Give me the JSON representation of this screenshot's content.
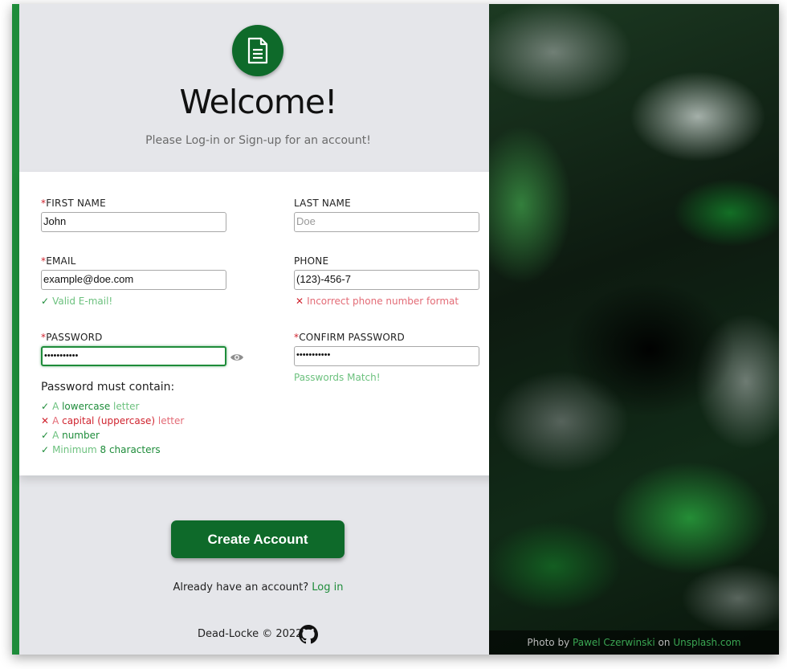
{
  "header": {
    "title": "Welcome!",
    "subtitle": "Please Log-in or Sign-up for an account!"
  },
  "form": {
    "first_name": {
      "label": "FIRST NAME",
      "required_mark": "*",
      "value": "John"
    },
    "last_name": {
      "label": "LAST NAME",
      "placeholder": "Doe"
    },
    "email": {
      "label": "EMAIL",
      "required_mark": "*",
      "value": "example@doe.com",
      "status": "Valid E-mail!"
    },
    "phone": {
      "label": "PHONE",
      "value": "(123)-456-7",
      "status": "Incorrect phone number format"
    },
    "password": {
      "label": "PASSWORD",
      "required_mark": "*",
      "value": "•••••••••••"
    },
    "confirm_password": {
      "label": "CONFIRM PASSWORD",
      "required_mark": "*",
      "value": "•••••••••••",
      "status": "Passwords Match!"
    }
  },
  "password_rules": {
    "title": "Password must contain:",
    "items": [
      {
        "prefix": "A ",
        "key": "lowercase",
        "suffix": " letter",
        "met": true
      },
      {
        "prefix": "A ",
        "key": "capital (uppercase)",
        "suffix": " letter",
        "met": false
      },
      {
        "prefix": "A ",
        "key": "number",
        "suffix": "",
        "met": true
      },
      {
        "prefix": "Minimum ",
        "key": "8 characters",
        "suffix": "",
        "met": true
      }
    ]
  },
  "actions": {
    "create_account": "Create Account",
    "already": "Already have an account?",
    "login": "Log in"
  },
  "footer": {
    "text": "Dead-Locke © 2022"
  },
  "photo_credit": {
    "by": "Photo by",
    "author": "Pawel Czerwinski",
    "on": "on",
    "site": "Unsplash.com"
  },
  "colors": {
    "accent": "#1e8c3a",
    "button": "#0e6a2a",
    "error": "#d0242f"
  },
  "icons": {
    "logo": "document-icon",
    "valid": "check-icon",
    "invalid": "x-icon",
    "toggle": "eye-icon",
    "github": "github-icon"
  }
}
